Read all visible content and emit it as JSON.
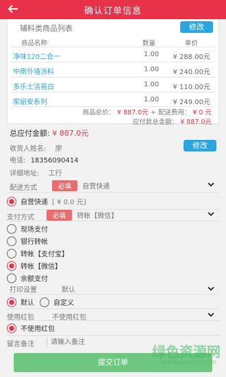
{
  "header": {
    "back_icon": "arrow-left-icon",
    "title": "确认订单信息"
  },
  "goods": {
    "heading": "辅料类商品列表",
    "edit_label": "修改",
    "columns": [
      "商品名称",
      "数量",
      "单价"
    ],
    "items": [
      {
        "name": "净味120二合一",
        "qty": "1.00",
        "price": "¥ 288.00元"
      },
      {
        "name": "中南外墙涂料",
        "qty": "1.00",
        "price": "¥ 240.00元"
      },
      {
        "name": "多乐士洁易白",
        "qty": "1.00",
        "price": "¥ 110.00元"
      },
      {
        "name": "家丽安系列",
        "qty": "1.00",
        "price": "¥ 249.00元"
      }
    ],
    "subtotal_label": "商品总价：",
    "subtotal_value": "¥ 887.0元",
    "shipping_label": "+ 配送费用：",
    "shipping_value": "¥ 0 元",
    "payable_label": "应付款总金额：",
    "payable_value": "¥ 887.0元"
  },
  "order": {
    "total_label": "总应付金额:",
    "total_value": "¥ 887.0元",
    "receiver_label": "收货人姓名:",
    "receiver_value": "廖",
    "edit_label": "修改",
    "phone_label": "电话:",
    "phone_value": "18356090414",
    "address_label": "详细地址:",
    "address_value": "工行"
  },
  "delivery": {
    "label": "配送方式",
    "required": "必填",
    "selected": "自营快递",
    "option_label": "自营快递",
    "option_value": "[ ¥  0.0 元]"
  },
  "payment": {
    "label": "支付方式",
    "required": "必填",
    "selected": "转帐【微信】",
    "options": [
      "现场支付",
      "银行转帐",
      "转帐【支付宝】",
      "转帐【微信】",
      "余额支付"
    ]
  },
  "print": {
    "label": "打印设置",
    "selected": "默认",
    "options": [
      "默认",
      "自定义"
    ]
  },
  "coupon": {
    "label": "使用红包",
    "selected": "不使用红包",
    "option": "不使用红包"
  },
  "remark": {
    "label": "留言备注",
    "placeholder": "请输入备注"
  },
  "submit_label": "提交订单",
  "watermark": {
    "main": "绿色资源网",
    "sub": "www.downcc.com"
  },
  "colors": {
    "primary": "#e8324a",
    "accent": "#2aa5e0",
    "submit": "#6ec77f"
  }
}
